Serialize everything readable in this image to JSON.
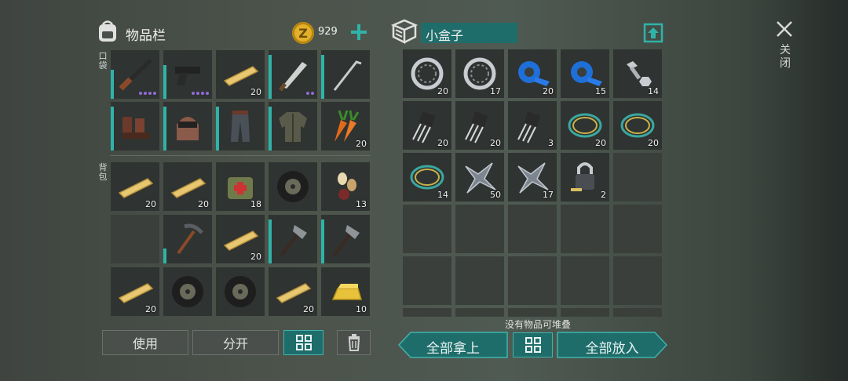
{
  "inventory": {
    "title": "物品栏",
    "coins": "929",
    "pocket_label": "口袋",
    "backpack_label": "背包",
    "pocket_items": [
      {
        "icon": "shotgun-icon",
        "count": "",
        "dots": 4,
        "dur": 0.6
      },
      {
        "icon": "pistol-icon",
        "count": "",
        "dots": 4,
        "dur": 0.7
      },
      {
        "icon": "plank-icon",
        "count": "20"
      },
      {
        "icon": "machete-icon",
        "count": "",
        "dots": 2,
        "dur": 0.9
      },
      {
        "icon": "crowbar-icon",
        "count": "",
        "dur": 0.9
      },
      {
        "icon": "boots-icon",
        "count": "",
        "dur": 0.9
      },
      {
        "icon": "helmet-icon",
        "count": "",
        "dur": 0.9
      },
      {
        "icon": "pants-icon",
        "count": "",
        "dur": 0.9
      },
      {
        "icon": "jacket-icon",
        "count": "",
        "dur": 0.9
      },
      {
        "icon": "carrot-icon",
        "count": "20"
      }
    ],
    "backpack_items": [
      {
        "icon": "plank-icon",
        "count": "20"
      },
      {
        "icon": "plank-icon",
        "count": "20"
      },
      {
        "icon": "medkit-bag-icon",
        "count": "18"
      },
      {
        "icon": "tire-icon",
        "count": ""
      },
      {
        "icon": "seeds-icon",
        "count": "13"
      },
      {
        "icon": "",
        "count": ""
      },
      {
        "icon": "pickaxe-icon",
        "count": "",
        "dur": 0.3
      },
      {
        "icon": "plank-icon",
        "count": "20"
      },
      {
        "icon": "hatchet-icon",
        "count": "",
        "dur": 0.9
      },
      {
        "icon": "hatchet-icon",
        "count": "",
        "dur": 0.9
      },
      {
        "icon": "plank-icon",
        "count": "20"
      },
      {
        "icon": "tire-icon",
        "count": ""
      },
      {
        "icon": "tire-icon",
        "count": ""
      },
      {
        "icon": "plank-icon",
        "count": "20"
      },
      {
        "icon": "gold-bar-icon",
        "count": "10"
      }
    ],
    "use_label": "使用",
    "split_label": "分开"
  },
  "box": {
    "title": "小盒子",
    "items": [
      {
        "icon": "bearing-icon",
        "count": "20"
      },
      {
        "icon": "bearing-icon",
        "count": "17"
      },
      {
        "icon": "tape-icon",
        "count": "20"
      },
      {
        "icon": "tape-icon",
        "count": "15"
      },
      {
        "icon": "bolt-nut-icon",
        "count": "14"
      },
      {
        "icon": "transistor-icon",
        "count": "20"
      },
      {
        "icon": "transistor-icon",
        "count": "20"
      },
      {
        "icon": "transistor-icon",
        "count": "3"
      },
      {
        "icon": "wire-coil-icon",
        "count": "20"
      },
      {
        "icon": "wire-coil-icon",
        "count": "20"
      },
      {
        "icon": "wire-coil-icon",
        "count": "14"
      },
      {
        "icon": "metal-scrap-icon",
        "count": "50"
      },
      {
        "icon": "metal-scrap-icon",
        "count": "17"
      },
      {
        "icon": "padlock-icon",
        "count": "2"
      }
    ],
    "status": "没有物品可堆叠",
    "take_all_label": "全部拿上",
    "put_all_label": "全部放入"
  },
  "close_label": "关闭",
  "colors": {
    "accent": "#2fb3a9",
    "rarity": "#8f6bd8"
  }
}
